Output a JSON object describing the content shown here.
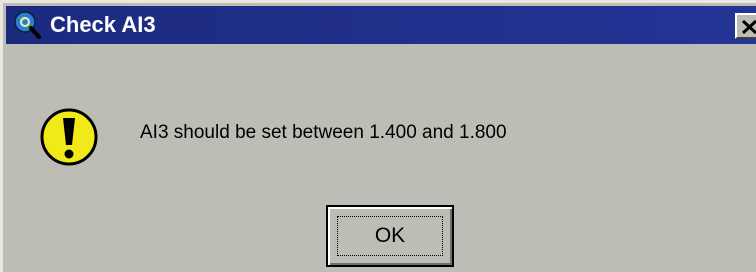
{
  "window": {
    "title": "Check AI3",
    "title_icon": "globe-search-icon",
    "close_icon": "close-icon"
  },
  "dialog": {
    "icon": "exclamation-warning-icon",
    "message": "AI3 should be set between 1.400 and 1.800",
    "ok_label": "OK"
  },
  "colors": {
    "titlebar": "#1c2a7e",
    "face": "#bdbdb5",
    "warning_fill": "#f2ea18"
  }
}
